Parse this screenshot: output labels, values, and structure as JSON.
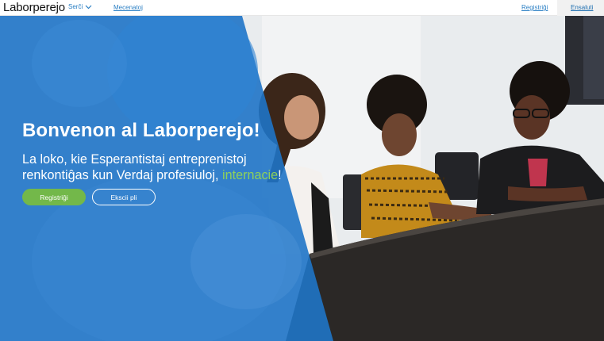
{
  "nav": {
    "brand": "Laborperejo",
    "search_label": "Serĉi",
    "mentors_label": "Mecenatoj",
    "register_label": "Registriĝi",
    "login_label": "Ensaluti"
  },
  "hero": {
    "title": "Bonvenon al Laborperejo!",
    "subtitle_line1": "La loko, kie Esperantistaj entreprenistoj",
    "subtitle_line2": "renkontiĝas kun Verdaj profesiuloj, ",
    "subtitle_accent": "internacie",
    "subtitle_end": "!",
    "register_button": "Registriĝi",
    "more_button": "Ekscii pli"
  },
  "colors": {
    "overlay_blue": "#1f74c7",
    "accent_green": "#8ed15c",
    "button_green": "#73b84a",
    "link_blue": "#2a7fc4"
  },
  "icons": {
    "search_dropdown": "chevron-down-icon"
  }
}
